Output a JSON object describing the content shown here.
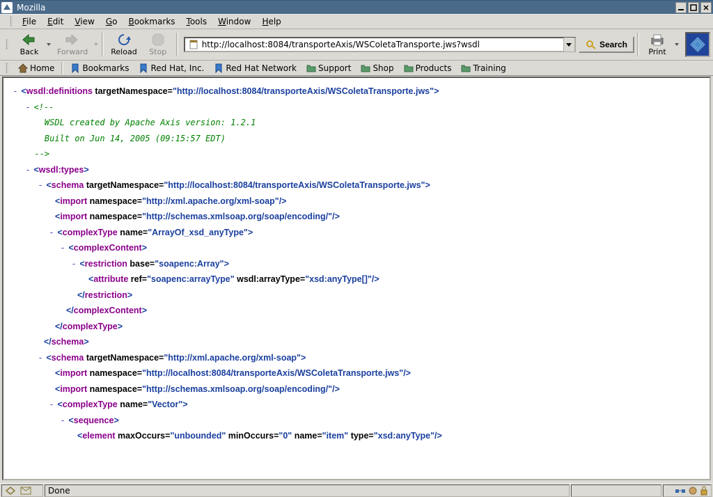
{
  "window": {
    "title": "Mozilla"
  },
  "menu": {
    "file": "File",
    "edit": "Edit",
    "view": "View",
    "go": "Go",
    "bookmarks": "Bookmarks",
    "tools": "Tools",
    "window": "Window",
    "help": "Help"
  },
  "toolbar": {
    "back": "Back",
    "forward": "Forward",
    "reload": "Reload",
    "stop": "Stop",
    "print": "Print",
    "search": "Search"
  },
  "url": {
    "value": "http://localhost:8084/transporteAxis/WSColetaTransporte.jws?wsdl"
  },
  "bookmarks": {
    "home": "Home",
    "bookmarks": "Bookmarks",
    "redhat": "Red Hat, Inc.",
    "rhn": "Red Hat Network",
    "support": "Support",
    "shop": "Shop",
    "products": "Products",
    "training": "Training"
  },
  "xml": {
    "l1_open": "<",
    "l1_tag": "wsdl:definitions",
    "l1_attr": " targetNamespace=",
    "l1_val": "\"http://localhost:8084/transporteAxis/WSColetaTransporte.jws\"",
    "l1_close": ">",
    "comment": "<!--\n    WSDL created by Apache Axis version: 1.2.1\n    Built on Jun 14, 2005 (09:15:57 EDT)\n  -->",
    "types_open": "<",
    "types_tag": "wsdl:types",
    "types_close": ">",
    "schema1_open": "<",
    "schema1_tag": "schema",
    "schema1_attr": " targetNamespace=",
    "schema1_val": "\"http://localhost:8084/transporteAxis/WSColetaTransporte.jws\"",
    "schema1_close": ">",
    "imp1_open": "<",
    "imp1_tag": "import",
    "imp_attr": " namespace=",
    "imp1_val": "\"http://xml.apache.org/xml-soap\"",
    "self_close": "/>",
    "imp2_val": "\"http://schemas.xmlsoap.org/soap/encoding/\"",
    "ct1_open": "<",
    "ct1_tag": "complexType",
    "ct_name_attr": " name=",
    "ct1_val": "\"ArrayOf_xsd_anyType\"",
    "cc_open": "<",
    "cc_tag": "complexContent",
    "rest_open": "<",
    "rest_tag": "restriction",
    "rest_attr": " base=",
    "rest_val": "\"soapenc:Array\"",
    "attrib_open": "<",
    "attrib_tag": "attribute",
    "attrib_ref": " ref=",
    "attrib_ref_val": "\"soapenc:arrayType\"",
    "attrib_wsdl": " wsdl:arrayType=",
    "attrib_wsdl_val": "\"xsd:anyType[]\"",
    "rest_close_open": "</",
    "cc_close_open": "</",
    "ct_close_open": "</",
    "schema_close_open": "</",
    "schema2_val": "\"http://xml.apache.org/xml-soap\"",
    "imp3_val": "\"http://localhost:8084/transporteAxis/WSColetaTransporte.jws\"",
    "ct2_val": "\"Vector\"",
    "seq_tag": "sequence",
    "elem_tag": "element",
    "elem_max": " maxOccurs=",
    "elem_max_val": "\"unbounded\"",
    "elem_min": " minOccurs=",
    "elem_min_val": "\"0\"",
    "elem_name": " name=",
    "elem_name_val": "\"item\"",
    "elem_type": " type=",
    "elem_type_val": "\"xsd:anyType\""
  },
  "status": {
    "message": "Done"
  }
}
